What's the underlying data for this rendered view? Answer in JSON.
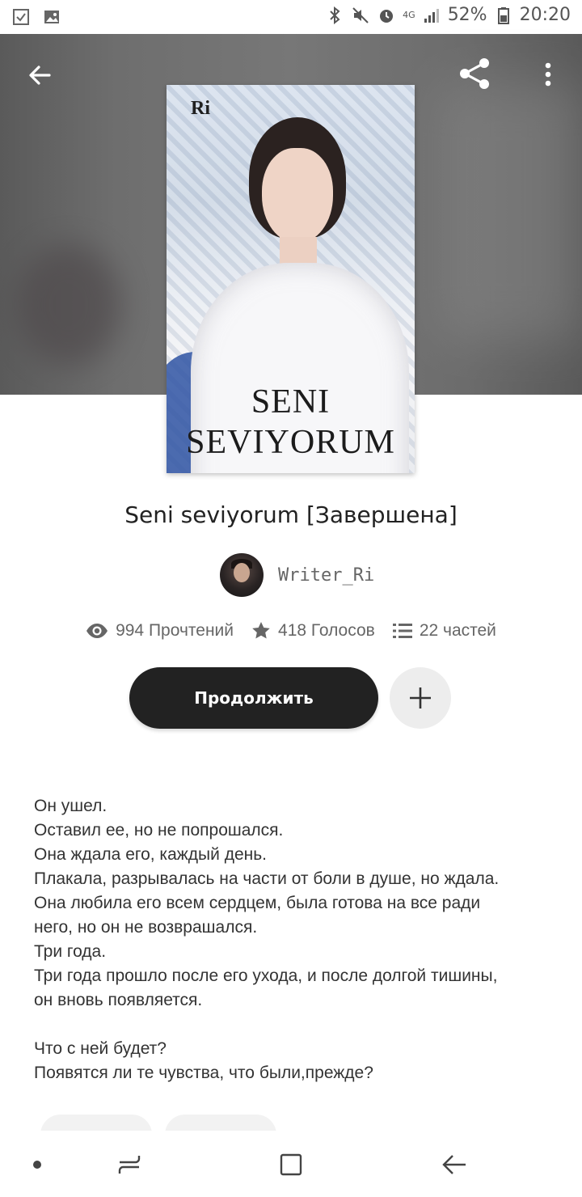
{
  "status_bar": {
    "battery": "52%",
    "time": "20:20",
    "network": "4G",
    "icons": [
      "checklist-icon",
      "image-icon",
      "bluetooth-icon",
      "mute-icon",
      "alarm-icon",
      "signal-icon",
      "battery-icon"
    ]
  },
  "header": {
    "back_icon": "arrow-left-icon",
    "share_icon": "share-icon",
    "menu_icon": "more-vertical-icon"
  },
  "cover": {
    "author_mark": "Ri",
    "title_line1": "SENI",
    "title_line2": "SEVIYORUM"
  },
  "story": {
    "title": "Seni seviyorum [Завершена]",
    "author": "Writer_Ri",
    "reads": "994 Прочтений",
    "votes": "418 Голосов",
    "parts": "22 частей"
  },
  "actions": {
    "continue_label": "Продолжить",
    "add_icon": "plus-icon"
  },
  "description": {
    "lines1": [
      "Он ушел.",
      "Оставил ее, но не попрошался.",
      "Она ждала его, каждый день.",
      "Плакала, разрывалась на части от боли в душе, но ждала.",
      "Она любила его всем сердцем, была готова на все ради",
      "него, но он не возврашался.",
      "Три года.",
      "Три года прошло после его ухода, и после долгой тишины,",
      "он вновь появляется."
    ],
    "lines2": [
      "Что с ней будет?",
      "Появятся ли те чувства, что были,прежде?"
    ]
  },
  "colors": {
    "header_bg": "#6e6e6e",
    "continue_bg": "#222222",
    "text": "#333333",
    "muted": "#666666"
  }
}
